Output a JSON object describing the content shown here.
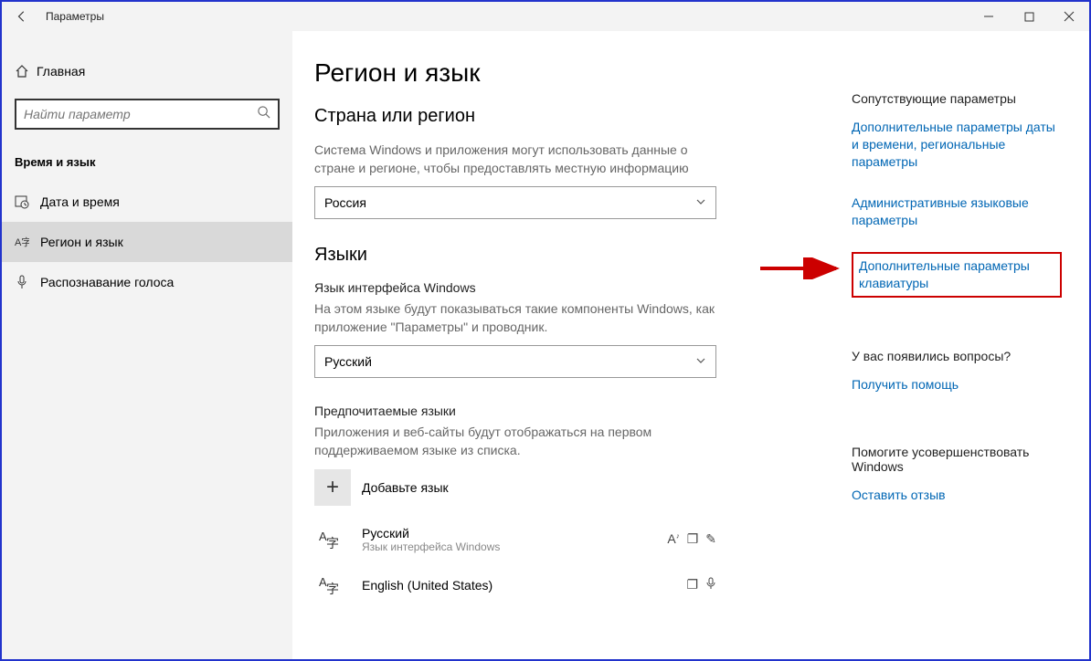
{
  "window": {
    "title": "Параметры"
  },
  "sidebar": {
    "home": "Главная",
    "search_placeholder": "Найти параметр",
    "section": "Время и язык",
    "items": [
      {
        "label": "Дата и время"
      },
      {
        "label": "Регион и язык"
      },
      {
        "label": "Распознавание голоса"
      }
    ]
  },
  "main": {
    "title": "Регион и язык",
    "region_heading": "Страна или регион",
    "region_desc": "Система Windows и приложения могут использовать данные о стране и регионе, чтобы предоставлять местную информацию",
    "region_value": "Россия",
    "lang_heading": "Языки",
    "display_lang_heading": "Язык интерфейса Windows",
    "display_lang_desc": "На этом языке будут показываться такие компоненты Windows, как приложение \"Параметры\" и проводник.",
    "display_lang_value": "Русский",
    "pref_heading": "Предпочитаемые языки",
    "pref_desc": "Приложения и веб-сайты будут отображаться на первом поддерживаемом языке из списка.",
    "add_lang": "Добавьте язык",
    "languages": [
      {
        "name": "Русский",
        "note": "Язык интерфейса Windows"
      },
      {
        "name": "English (United States)",
        "note": ""
      }
    ]
  },
  "right": {
    "related_title": "Сопутствующие параметры",
    "link1": "Дополнительные параметры даты и времени, региональные параметры",
    "link2": "Административные языковые параметры",
    "link3": "Дополнительные параметры клавиатуры",
    "question_title": "У вас появились вопросы?",
    "help_link": "Получить помощь",
    "improve_title": "Помогите усовершенствовать Windows",
    "feedback_link": "Оставить отзыв"
  }
}
